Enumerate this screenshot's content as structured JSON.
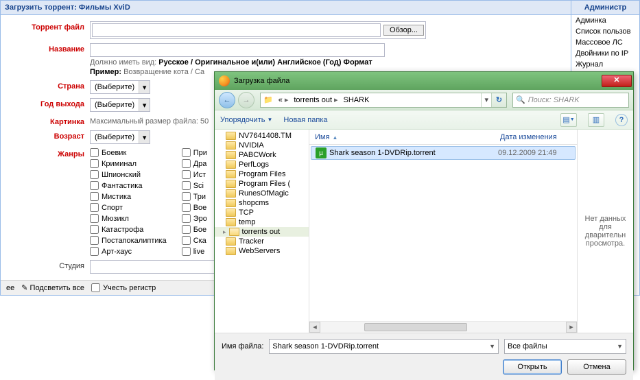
{
  "form": {
    "header": "Загрузить торрент: Фильмы XviD",
    "labels": {
      "torrent_file": "Торрент файл",
      "title": "Название",
      "country": "Страна",
      "year": "Год выхода",
      "picture": "Картинка",
      "age": "Возраст",
      "genres": "Жанры",
      "studio": "Студия"
    },
    "browse_btn": "Обзор...",
    "title_hint_prefix": "Должно иметь вид: ",
    "title_hint_bold": "Русское / Оригинальное и(или) Английское (Год) Формат",
    "title_example_prefix": "Пример: ",
    "title_example": "Возвращение кота / Ca",
    "select_placeholder": "(Выберите)",
    "picture_hint": "Максимальный размер файла: 50",
    "genres_col1": [
      "Боевик",
      "Криминал",
      "Шпионский",
      "Фантастика",
      "Мистика",
      "Спорт",
      "Мюзикл",
      "Катастрофа",
      "Постапокалиптика",
      "Арт-хаус"
    ],
    "genres_col2": [
      "При",
      "Дра",
      "Ист",
      "Sci",
      "Три",
      "Вое",
      "Эро",
      "Бое",
      "Ска",
      "live"
    ]
  },
  "sidebar": {
    "header": "Администр",
    "items": [
      "Админка",
      "Список пользов",
      "Массовое ЛС",
      "Двойники по IP",
      "Журнал"
    ]
  },
  "bottombar": {
    "ee": "ее",
    "highlight": "Подсветить все",
    "caseSensitive": "Учесть регистр"
  },
  "dialog": {
    "title": "Загрузка файла",
    "breadcrumb": [
      "torrents out",
      "SHARK"
    ],
    "search_placeholder": "Поиск: SHARK",
    "toolbar": {
      "organize": "Упорядочить",
      "newfolder": "Новая папка"
    },
    "tree": [
      "NV7641408.TM",
      "NVIDIA",
      "PABCWork",
      "PerfLogs",
      "Program Files",
      "Program Files (",
      "RunesOfMagic",
      "shopcms",
      "TCP",
      "temp",
      "torrents out",
      "Tracker",
      "WebServers"
    ],
    "tree_selected": "torrents out",
    "columns": {
      "name": "Имя",
      "date": "Дата изменения"
    },
    "files": [
      {
        "name": "Shark season 1-DVDRip.torrent",
        "date": "09.12.2009 21:49",
        "selected": true
      }
    ],
    "preview_text": "Нет данных для дварительн просмотра.",
    "footer": {
      "filename_label": "Имя файла:",
      "filename_value": "Shark season 1-DVDRip.torrent",
      "filter": "Все файлы",
      "open": "Открыть",
      "cancel": "Отмена"
    }
  }
}
